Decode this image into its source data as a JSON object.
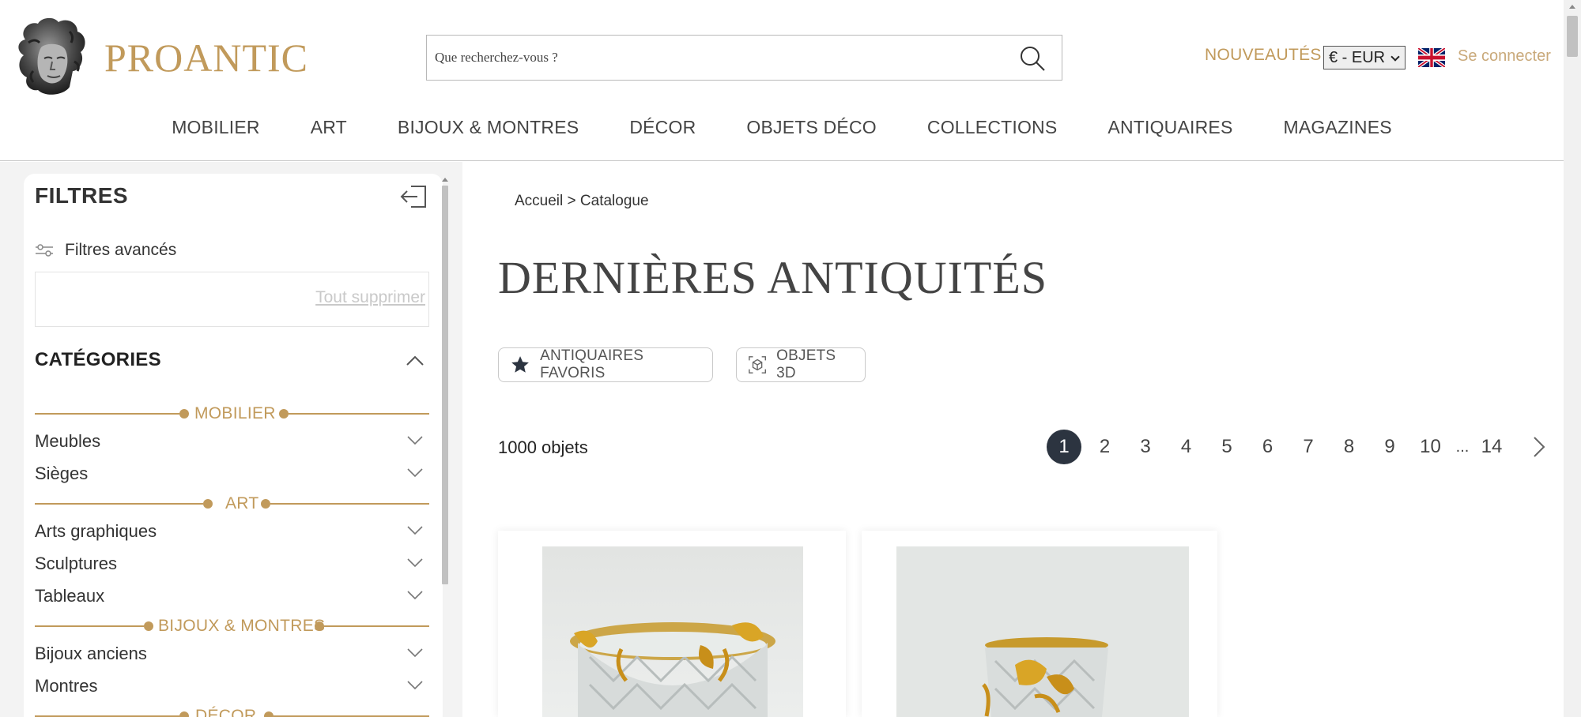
{
  "header": {
    "logo_text": "PROANTIC",
    "search_placeholder": "Que recherchez-vous ?",
    "nouveautes": "NOUVEAUTÉS",
    "currency": "€ - EUR",
    "login": "Se connecter"
  },
  "nav": {
    "items": [
      "MOBILIER",
      "ART",
      "BIJOUX & MONTRES",
      "DÉCOR",
      "OBJETS DÉCO",
      "COLLECTIONS",
      "ANTIQUAIRES",
      "MAGAZINES"
    ]
  },
  "sidebar": {
    "title": "FILTRES",
    "advanced_filters": "Filtres avancés",
    "clear_all": "Tout supprimer",
    "categories_title": "CATÉGORIES",
    "sections": [
      {
        "label": "MOBILIER",
        "items": [
          "Meubles",
          "Sièges"
        ]
      },
      {
        "label": "ART",
        "items": [
          "Arts graphiques",
          "Sculptures",
          "Tableaux"
        ]
      },
      {
        "label": "BIJOUX & MONTRES",
        "items": [
          "Bijoux anciens",
          "Montres"
        ]
      },
      {
        "label": "DÉCOR",
        "items": []
      }
    ]
  },
  "main": {
    "breadcrumb": {
      "home": "Accueil",
      "separator": ">",
      "current": "Catalogue"
    },
    "title": "DERNIÈRES ANTIQUITÉS",
    "chips": {
      "favorites": "ANTIQUAIRES FAVORIS",
      "objects_3d": "OBJETS 3D"
    },
    "count": "1000 objets",
    "pagination": {
      "pages": [
        "1",
        "2",
        "3",
        "4",
        "5",
        "6",
        "7",
        "8",
        "9",
        "10"
      ],
      "ellipsis": "...",
      "last": "14",
      "current": "1"
    }
  },
  "colors": {
    "gold": "#c19a5b",
    "dark": "#2c3440",
    "text": "#333333"
  },
  "icons": [
    "proantic-logo-icon",
    "search-icon",
    "uk-flag-icon",
    "collapse-sidebar-icon",
    "sliders-icon",
    "chevron-up-icon",
    "chevron-down-icon",
    "star-icon",
    "cube-3d-icon",
    "chevron-right-icon"
  ]
}
